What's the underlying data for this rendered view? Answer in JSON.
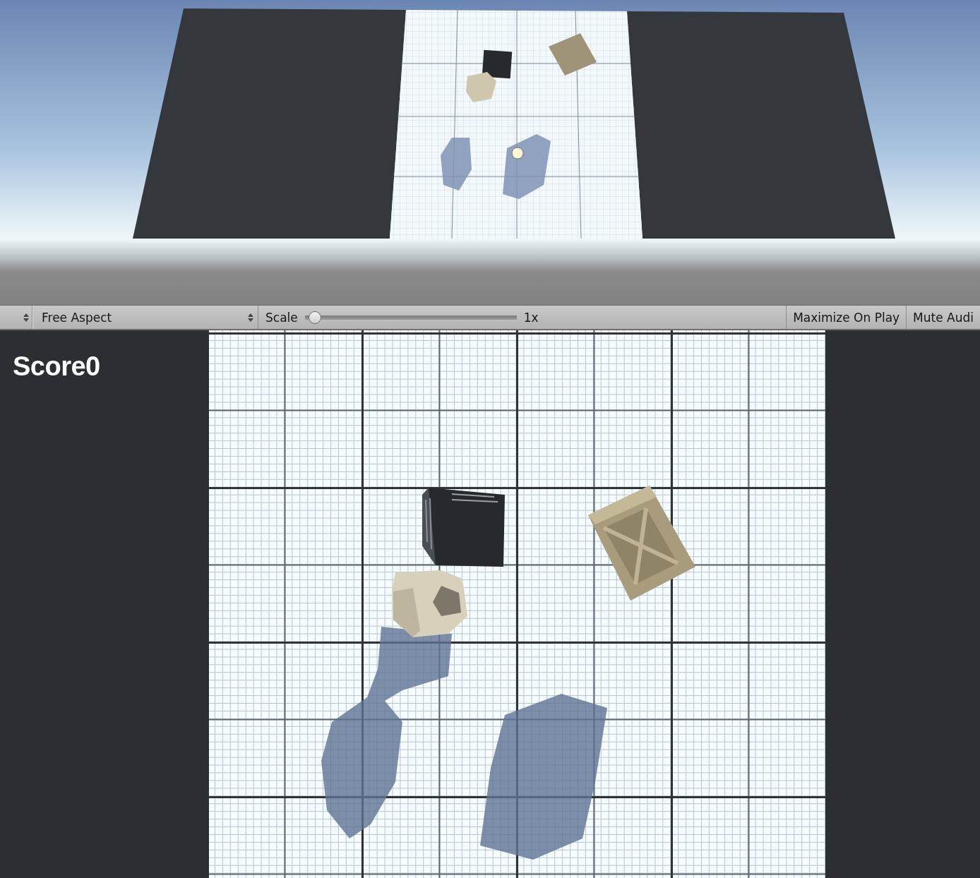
{
  "toolbar": {
    "display_dropdown": {
      "kind": "stepper"
    },
    "aspect_dropdown": {
      "value": "Free Aspect"
    },
    "scale": {
      "label": "Scale",
      "level": 0.02,
      "reading": "1x"
    },
    "toggles": [
      {
        "label": "Maximize On Play",
        "on": false
      },
      {
        "label": "Mute Audi",
        "on": false
      }
    ]
  },
  "game_view": {
    "score": "Score0"
  }
}
